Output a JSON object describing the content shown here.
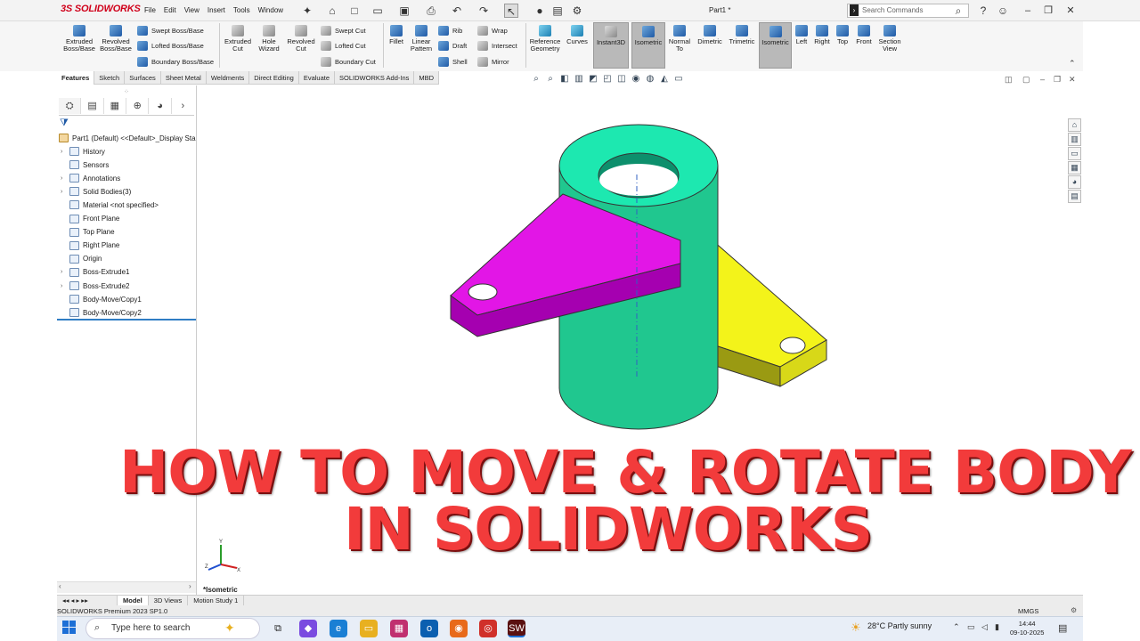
{
  "titlebar": {
    "logo": "3S SOLIDWORKS",
    "menus": [
      "File",
      "Edit",
      "View",
      "Insert",
      "Tools",
      "Window"
    ],
    "doc_title": "Part1 *",
    "search_placeholder": "Search Commands"
  },
  "ribbon": {
    "extruded_boss": "Extruded Boss/Base",
    "revolved_boss": "Revolved Boss/Base",
    "swept_boss": "Swept Boss/Base",
    "lofted_boss": "Lofted Boss/Base",
    "boundary_boss": "Boundary Boss/Base",
    "extruded_cut": "Extruded Cut",
    "hole_wizard": "Hole Wizard",
    "revolved_cut": "Revolved Cut",
    "swept_cut": "Swept Cut",
    "lofted_cut": "Lofted Cut",
    "boundary_cut": "Boundary Cut",
    "fillet": "Fillet",
    "linear_pattern": "Linear Pattern",
    "rib": "Rib",
    "draft": "Draft",
    "shell": "Shell",
    "wrap": "Wrap",
    "intersect": "Intersect",
    "mirror": "Mirror",
    "reference_geometry": "Reference Geometry",
    "curves": "Curves",
    "instant3d": "Instant3D",
    "isometric": "Isometric",
    "normal_to": "Normal To",
    "dimetric": "Dimetric",
    "trimetric": "Trimetric",
    "isometric2": "Isometric",
    "left": "Left",
    "right": "Right",
    "top": "Top",
    "front": "Front",
    "section_view": "Section View"
  },
  "tabs": [
    "Features",
    "Sketch",
    "Surfaces",
    "Sheet Metal",
    "Weldments",
    "Direct Editing",
    "Evaluate",
    "SOLIDWORKS Add-Ins",
    "MBD"
  ],
  "feature_tree": {
    "root": "Part1 (Default) <<Default>_Display Sta",
    "items": [
      {
        "label": "History",
        "arrow": true
      },
      {
        "label": "Sensors",
        "arrow": false
      },
      {
        "label": "Annotations",
        "arrow": true
      },
      {
        "label": "Solid Bodies(3)",
        "arrow": true
      },
      {
        "label": "Material <not specified>",
        "arrow": false
      },
      {
        "label": "Front Plane",
        "arrow": false
      },
      {
        "label": "Top Plane",
        "arrow": false
      },
      {
        "label": "Right Plane",
        "arrow": false
      },
      {
        "label": "Origin",
        "arrow": false
      },
      {
        "label": "Boss-Extrude1",
        "arrow": true
      },
      {
        "label": "Boss-Extrude2",
        "arrow": true
      },
      {
        "label": "Body-Move/Copy1",
        "arrow": false
      },
      {
        "label": "Body-Move/Copy2",
        "arrow": false
      }
    ]
  },
  "graphics": {
    "view_name": "*Isometric",
    "banner_line1": "HOW TO MOVE & ROTATE BODY",
    "banner_line2": "IN SOLIDWORKS",
    "colors": {
      "cylinder": "#1de8b0",
      "arm_magenta": "#e216e6",
      "arm_yellow": "#f3f31a"
    }
  },
  "bottom_tabs": [
    "Model",
    "3D Views",
    "Motion Study 1"
  ],
  "status": {
    "product": "SOLIDWORKS Premium 2023 SP1.0",
    "units": "MMGS"
  },
  "taskbar": {
    "search_placeholder": "Type here to search",
    "weather": "28°C  Partly sunny",
    "time": "14:44",
    "date": "09-10-2025"
  }
}
